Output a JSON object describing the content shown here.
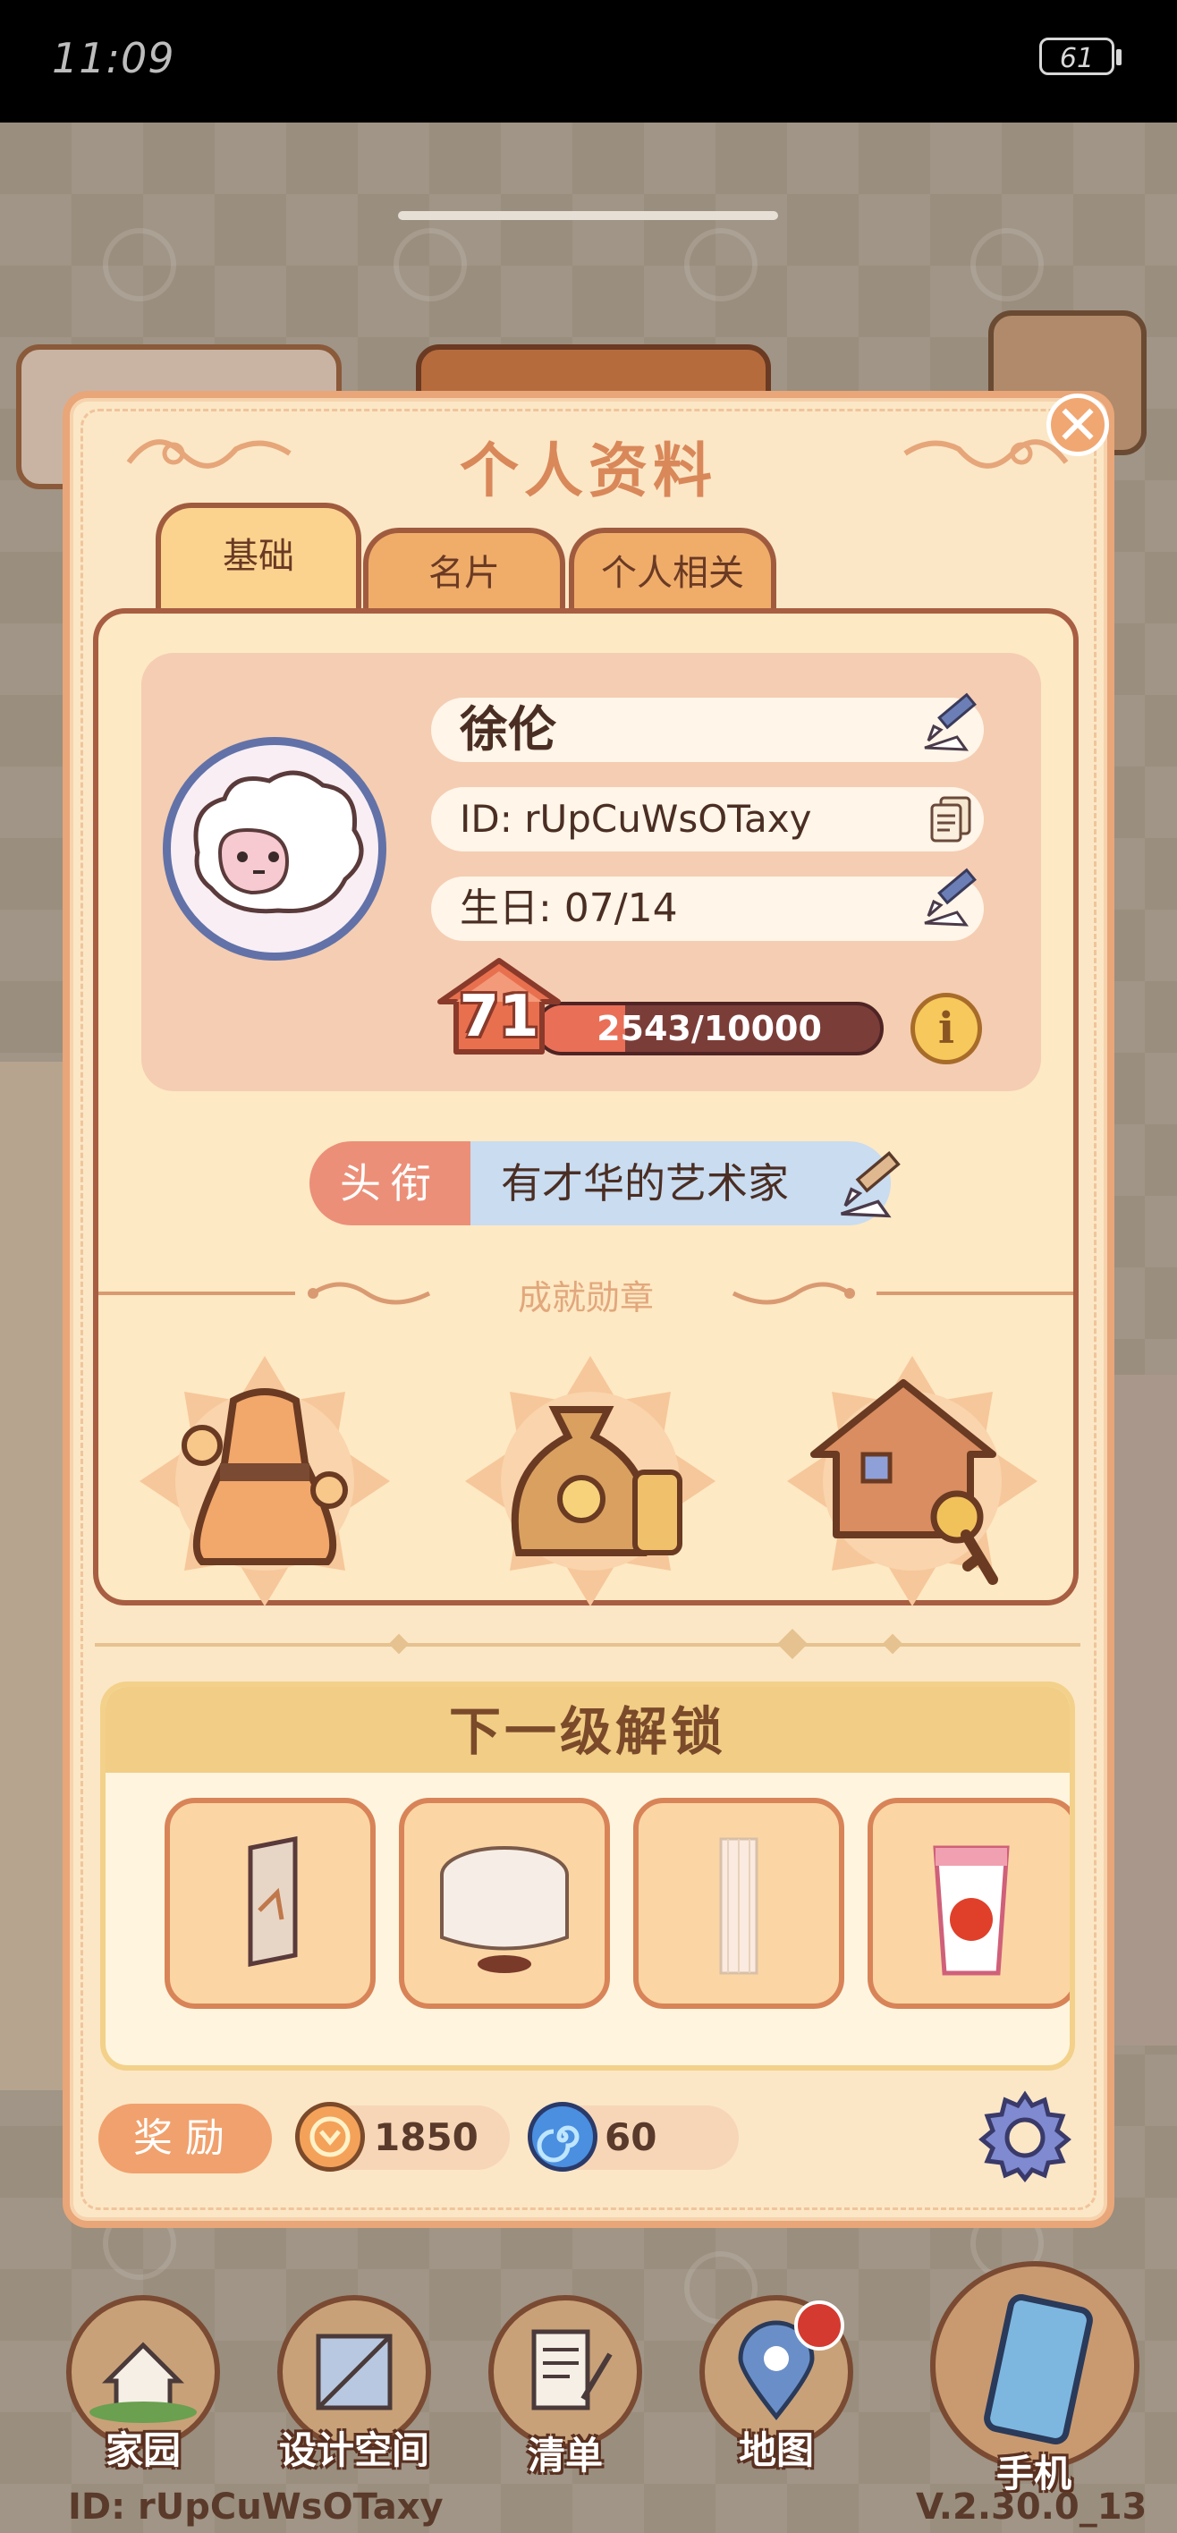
{
  "status_bar": {
    "time": "11:09",
    "battery": "61"
  },
  "dialog": {
    "title": "个人资料",
    "tabs": [
      {
        "label": "基础",
        "active": true
      },
      {
        "label": "名片",
        "active": false
      },
      {
        "label": "个人相关",
        "active": false
      }
    ],
    "profile": {
      "name": "徐伦",
      "id": "ID: rUpCuWsOTaxy",
      "birthday": "生日: 07/14",
      "level": "71",
      "xp_text": "2543/10000",
      "xp_fraction": 0.2543
    },
    "title_tag": {
      "label": "头衔",
      "value": "有才华的艺术家"
    },
    "achievements": {
      "header": "成就勋章",
      "badges": [
        "dress-badge-icon",
        "money-bag-badge-icon",
        "house-key-badge-icon"
      ]
    },
    "unlock": {
      "header": "下一级解锁",
      "items": [
        "screen-item-icon",
        "round-table-item-icon",
        "curtain-item-icon",
        "apple-cup-item-icon"
      ]
    },
    "rewards": {
      "label": "奖励",
      "coins": "1850",
      "gems": "60"
    }
  },
  "nav": [
    {
      "label": "家园",
      "icon": "home-garden-icon"
    },
    {
      "label": "设计空间",
      "icon": "design-ruler-icon"
    },
    {
      "label": "清单",
      "icon": "list-quill-icon"
    },
    {
      "label": "地图",
      "icon": "map-pin-icon"
    },
    {
      "label": "手机",
      "icon": "phone-icon"
    }
  ],
  "footer": {
    "id": "ID: rUpCuWsOTaxy",
    "version": "V.2.30.0_13"
  },
  "colors": {
    "accent": "#e9a678",
    "title": "#d9885a",
    "tag": "#ec8f78",
    "xp_bar": "#7b3d38"
  }
}
